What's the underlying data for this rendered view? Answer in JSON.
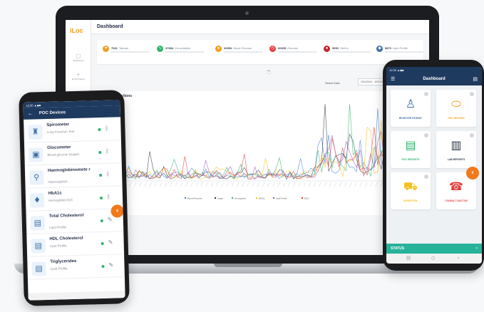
{
  "laptop": {
    "logo": "iLoc",
    "nav": [
      {
        "icon": "dashboard-icon",
        "glyph": "▢",
        "label": "Dashboard"
      },
      {
        "icon": "plus-icon",
        "glyph": "+",
        "label": "Enroll Patient"
      }
    ],
    "title": "Dashboard",
    "stats": [
      {
        "icon": "heart-icon",
        "glyph": "♥",
        "color": "#f29e1f",
        "value": "7061",
        "label": "Tabular"
      },
      {
        "icon": "pulse-icon",
        "glyph": "∿",
        "color": "#2fb36d",
        "value": "47684",
        "label": "Consultation"
      },
      {
        "icon": "drop-icon",
        "glyph": "●",
        "color": "#f29e1f",
        "value": "32954",
        "label": "Blood Glucose"
      },
      {
        "icon": "clock-icon",
        "glyph": "◷",
        "color": "#e23b3b",
        "value": "60635",
        "label": "Glucose"
      },
      {
        "icon": "blood-drop-icon",
        "glyph": "●",
        "color": "#c0262d",
        "value": "5693",
        "label": "HbA1c"
      },
      {
        "icon": "lipid-icon",
        "glyph": "◆",
        "color": "#3d6fa8",
        "value": "5873",
        "label": "Lipid Profile"
      }
    ],
    "select_date_label": "Select Date",
    "select_date_value": "1/01/2019 - 12/31/2019",
    "chart_title": "POC Transactions",
    "legend": [
      {
        "name": "Blood Pressure",
        "color": "#3b7ddd"
      },
      {
        "name": "Sugar",
        "color": "#2d3748"
      },
      {
        "name": "Hemoglobin",
        "color": "#2fb36d"
      },
      {
        "name": "HbA1c",
        "color": "#f2c01f"
      },
      {
        "name": "Lipid Profile",
        "color": "#9b59b6"
      },
      {
        "name": "ECG",
        "color": "#e23b3b"
      }
    ]
  },
  "phone_left": {
    "status": "12:30 ▲◆■",
    "back_icon": "←",
    "title": "POC Devices",
    "devices": [
      {
        "name": "Spirometer",
        "sub": "Lung Function Test",
        "icon": "lungs-icon",
        "glyph": "♜",
        "action": "bluetooth-icon",
        "action_glyph": "ᛒ"
      },
      {
        "name": "Glucometer",
        "sub": "Blood glucose (sugar)",
        "icon": "glucometer-icon",
        "glyph": "▣",
        "action": "bluetooth-icon",
        "action_glyph": "ᛒ"
      },
      {
        "name": "Haemoglobinomete r",
        "sub": "Haemoglobin",
        "icon": "magnifier-icon",
        "glyph": "⚲",
        "action": "bluetooth-icon",
        "action_glyph": "ᛒ"
      },
      {
        "name": "HbA1c",
        "sub": "Hemoglobin A1C",
        "icon": "blood-test-icon",
        "glyph": "♦",
        "action": "bluetooth-icon",
        "action_glyph": "ᛒ"
      },
      {
        "name": "Total Cholesterol",
        "sub": "Lipid Profile",
        "icon": "lipid-chart-icon",
        "glyph": "▤",
        "action": "pen-icon",
        "action_glyph": "✎"
      },
      {
        "name": "HDL Cholesterol",
        "sub": "Lipid Profile",
        "icon": "lipid-chart-icon",
        "glyph": "▤",
        "action": "pen-icon",
        "action_glyph": "✎"
      },
      {
        "name": "Triglycerides",
        "sub": "Lipid Profile",
        "icon": "lipid-chart-icon",
        "glyph": "▤",
        "action": "pen-icon",
        "action_glyph": "✎"
      }
    ],
    "fab": "‹"
  },
  "phone_right": {
    "status": "12:30 ▲◆■",
    "menu_icon": "☰",
    "title": "Dashboard",
    "more_icon": "▤",
    "tiles": [
      {
        "label": "REGISTER PATIENT",
        "icon": "register-patient-icon",
        "glyph": "♙",
        "color": "#3d6fa8"
      },
      {
        "label": "POC DEVICES",
        "icon": "poc-device-icon",
        "glyph": "⬭",
        "color": "#f29e1f"
      },
      {
        "label": "POC REPORTS",
        "icon": "reports-icon",
        "glyph": "▤",
        "color": "#2fb36d"
      },
      {
        "label": "LAB REPORTS",
        "icon": "lab-report-icon",
        "glyph": "▥",
        "color": "#2d3748"
      },
      {
        "label": "INVENTORY",
        "icon": "cart-icon",
        "glyph": "⛟",
        "color": "#f2c01f"
      },
      {
        "label": "CONSULT DOCTOR",
        "icon": "consult-icon",
        "glyph": "☎",
        "color": "#e23b3b"
      }
    ],
    "fab": "‹",
    "status_label": "STATUS",
    "status_arrow": "›",
    "nav_icons": [
      "|||",
      "○",
      "‹"
    ]
  }
}
